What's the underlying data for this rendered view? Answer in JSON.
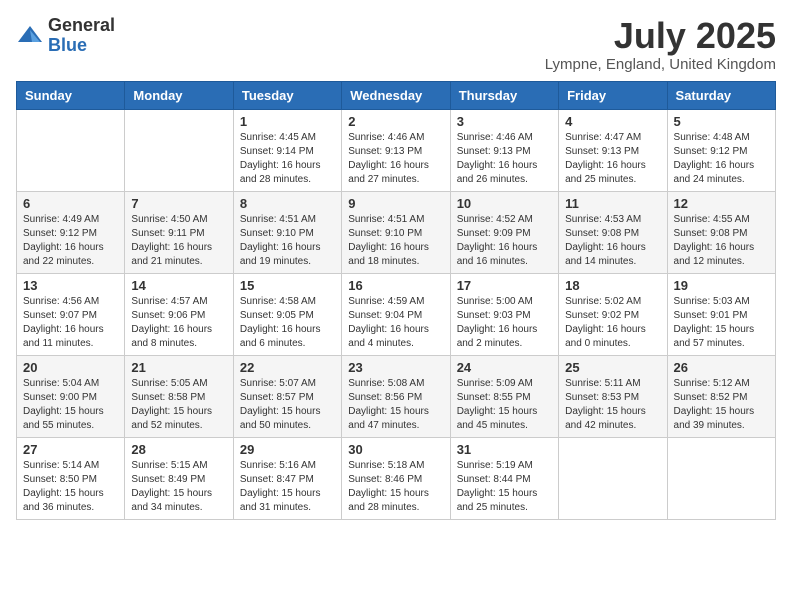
{
  "logo": {
    "general": "General",
    "blue": "Blue"
  },
  "title": "July 2025",
  "subtitle": "Lympne, England, United Kingdom",
  "weekdays": [
    "Sunday",
    "Monday",
    "Tuesday",
    "Wednesday",
    "Thursday",
    "Friday",
    "Saturday"
  ],
  "weeks": [
    [
      {
        "day": null,
        "info": null
      },
      {
        "day": null,
        "info": null
      },
      {
        "day": "1",
        "info": "Sunrise: 4:45 AM\nSunset: 9:14 PM\nDaylight: 16 hours and 28 minutes."
      },
      {
        "day": "2",
        "info": "Sunrise: 4:46 AM\nSunset: 9:13 PM\nDaylight: 16 hours and 27 minutes."
      },
      {
        "day": "3",
        "info": "Sunrise: 4:46 AM\nSunset: 9:13 PM\nDaylight: 16 hours and 26 minutes."
      },
      {
        "day": "4",
        "info": "Sunrise: 4:47 AM\nSunset: 9:13 PM\nDaylight: 16 hours and 25 minutes."
      },
      {
        "day": "5",
        "info": "Sunrise: 4:48 AM\nSunset: 9:12 PM\nDaylight: 16 hours and 24 minutes."
      }
    ],
    [
      {
        "day": "6",
        "info": "Sunrise: 4:49 AM\nSunset: 9:12 PM\nDaylight: 16 hours and 22 minutes."
      },
      {
        "day": "7",
        "info": "Sunrise: 4:50 AM\nSunset: 9:11 PM\nDaylight: 16 hours and 21 minutes."
      },
      {
        "day": "8",
        "info": "Sunrise: 4:51 AM\nSunset: 9:10 PM\nDaylight: 16 hours and 19 minutes."
      },
      {
        "day": "9",
        "info": "Sunrise: 4:51 AM\nSunset: 9:10 PM\nDaylight: 16 hours and 18 minutes."
      },
      {
        "day": "10",
        "info": "Sunrise: 4:52 AM\nSunset: 9:09 PM\nDaylight: 16 hours and 16 minutes."
      },
      {
        "day": "11",
        "info": "Sunrise: 4:53 AM\nSunset: 9:08 PM\nDaylight: 16 hours and 14 minutes."
      },
      {
        "day": "12",
        "info": "Sunrise: 4:55 AM\nSunset: 9:08 PM\nDaylight: 16 hours and 12 minutes."
      }
    ],
    [
      {
        "day": "13",
        "info": "Sunrise: 4:56 AM\nSunset: 9:07 PM\nDaylight: 16 hours and 11 minutes."
      },
      {
        "day": "14",
        "info": "Sunrise: 4:57 AM\nSunset: 9:06 PM\nDaylight: 16 hours and 8 minutes."
      },
      {
        "day": "15",
        "info": "Sunrise: 4:58 AM\nSunset: 9:05 PM\nDaylight: 16 hours and 6 minutes."
      },
      {
        "day": "16",
        "info": "Sunrise: 4:59 AM\nSunset: 9:04 PM\nDaylight: 16 hours and 4 minutes."
      },
      {
        "day": "17",
        "info": "Sunrise: 5:00 AM\nSunset: 9:03 PM\nDaylight: 16 hours and 2 minutes."
      },
      {
        "day": "18",
        "info": "Sunrise: 5:02 AM\nSunset: 9:02 PM\nDaylight: 16 hours and 0 minutes."
      },
      {
        "day": "19",
        "info": "Sunrise: 5:03 AM\nSunset: 9:01 PM\nDaylight: 15 hours and 57 minutes."
      }
    ],
    [
      {
        "day": "20",
        "info": "Sunrise: 5:04 AM\nSunset: 9:00 PM\nDaylight: 15 hours and 55 minutes."
      },
      {
        "day": "21",
        "info": "Sunrise: 5:05 AM\nSunset: 8:58 PM\nDaylight: 15 hours and 52 minutes."
      },
      {
        "day": "22",
        "info": "Sunrise: 5:07 AM\nSunset: 8:57 PM\nDaylight: 15 hours and 50 minutes."
      },
      {
        "day": "23",
        "info": "Sunrise: 5:08 AM\nSunset: 8:56 PM\nDaylight: 15 hours and 47 minutes."
      },
      {
        "day": "24",
        "info": "Sunrise: 5:09 AM\nSunset: 8:55 PM\nDaylight: 15 hours and 45 minutes."
      },
      {
        "day": "25",
        "info": "Sunrise: 5:11 AM\nSunset: 8:53 PM\nDaylight: 15 hours and 42 minutes."
      },
      {
        "day": "26",
        "info": "Sunrise: 5:12 AM\nSunset: 8:52 PM\nDaylight: 15 hours and 39 minutes."
      }
    ],
    [
      {
        "day": "27",
        "info": "Sunrise: 5:14 AM\nSunset: 8:50 PM\nDaylight: 15 hours and 36 minutes."
      },
      {
        "day": "28",
        "info": "Sunrise: 5:15 AM\nSunset: 8:49 PM\nDaylight: 15 hours and 34 minutes."
      },
      {
        "day": "29",
        "info": "Sunrise: 5:16 AM\nSunset: 8:47 PM\nDaylight: 15 hours and 31 minutes."
      },
      {
        "day": "30",
        "info": "Sunrise: 5:18 AM\nSunset: 8:46 PM\nDaylight: 15 hours and 28 minutes."
      },
      {
        "day": "31",
        "info": "Sunrise: 5:19 AM\nSunset: 8:44 PM\nDaylight: 15 hours and 25 minutes."
      },
      {
        "day": null,
        "info": null
      },
      {
        "day": null,
        "info": null
      }
    ]
  ]
}
